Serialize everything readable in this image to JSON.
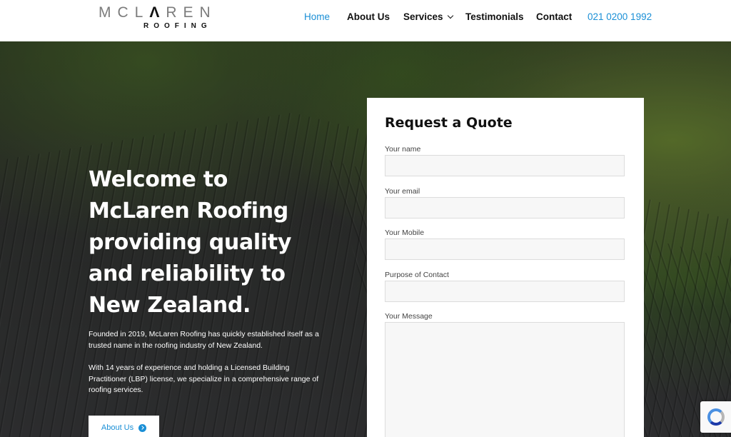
{
  "brand": {
    "logo_word_left": "MCL",
    "logo_word_mark": "Λ",
    "logo_word_right": "REN",
    "logo_sub": "ROOFING"
  },
  "nav": {
    "items": [
      {
        "label": "Home",
        "active": true
      },
      {
        "label": "About Us"
      },
      {
        "label": "Services"
      },
      {
        "label": "Testimonials"
      },
      {
        "label": "Contact"
      }
    ],
    "phone": "021 0200 1992"
  },
  "hero": {
    "title": "Welcome to McLaren Roofing providing quality and reliability to New Zealand.",
    "paragraph1": "Founded in 2019, McLaren Roofing has quickly established itself as a trusted name in the roofing industry of New Zealand.",
    "paragraph2": "With 14 years of experience and holding a Licensed Building Practitioner (LBP) license, we specialize in a comprehensive range of roofing services.",
    "button_label": "About Us"
  },
  "form": {
    "title": "Request a Quote",
    "fields": [
      {
        "label": "Your name",
        "value": ""
      },
      {
        "label": "Your email",
        "value": ""
      },
      {
        "label": "Your Mobile",
        "value": ""
      },
      {
        "label": "Purpose of Contact",
        "value": ""
      },
      {
        "label": "Your Message",
        "value": ""
      }
    ]
  },
  "colors": {
    "accent": "#1a8fd6",
    "text": "#111111"
  }
}
